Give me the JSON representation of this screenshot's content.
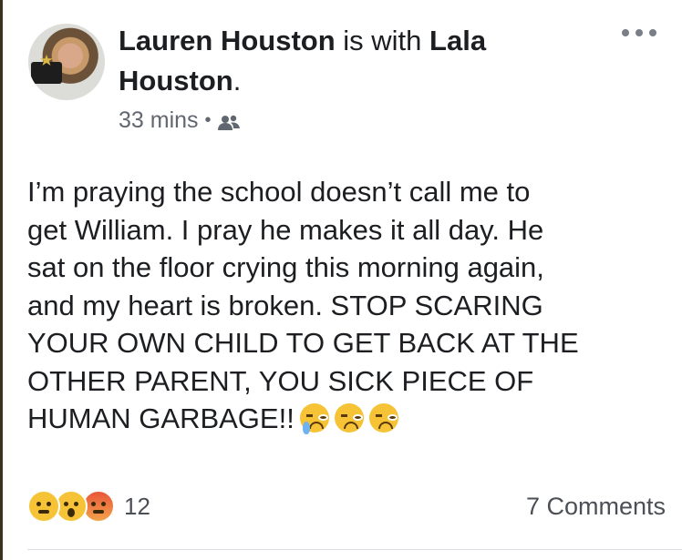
{
  "post": {
    "author": "Lauren Houston",
    "with_text": " is with ",
    "tagged": "Lala",
    "tagged_last": "Houston",
    "tagged_suffix": ".",
    "timestamp": "33 mins",
    "meta_separator": "•",
    "audience_icon": "friends-icon",
    "more_icon": "ellipsis-icon",
    "avatar_badge_text": "I SUPPORT MEDICAL CANNABIS",
    "body_text": "I’m praying the school doesn’t call me to\nget William. I pray he makes it all day. He\nsat on the floor crying this morning again,\nand my heart is broken. STOP SCARING\nYOUR OWN CHILD TO GET BACK AT THE\nOTHER PARENT, YOU SICK PIECE OF\nHUMAN GARBAGE!!",
    "body_emojis": [
      "loudly-crying-face",
      "tired-face",
      "angry-face"
    ]
  },
  "footer": {
    "reactions": [
      "sad",
      "wow",
      "angry"
    ],
    "reaction_count": "12",
    "comments_label": "7 Comments"
  },
  "colors": {
    "text": "#1c1e21",
    "meta": "#616770",
    "divider": "#dadde1"
  }
}
